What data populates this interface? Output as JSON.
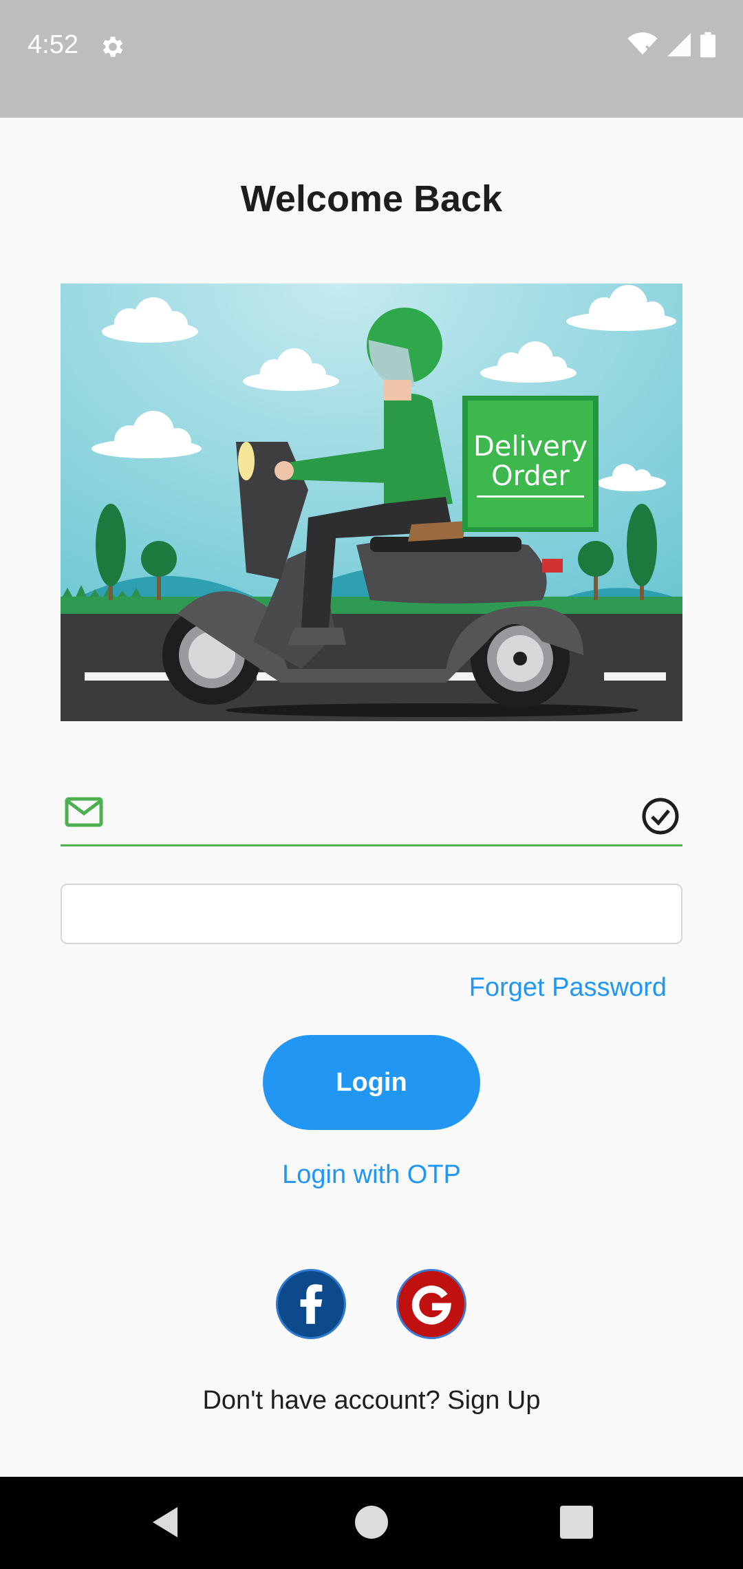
{
  "status_bar": {
    "time": "4:52",
    "icons": [
      "gear-icon",
      "wifi-icon",
      "signal-icon",
      "battery-icon"
    ]
  },
  "page": {
    "title": "Welcome Back",
    "hero_image": {
      "box_text_line1": "Delivery",
      "box_text_line2": "Order"
    }
  },
  "form": {
    "email": {
      "value": "",
      "placeholder": "",
      "icon": "mail-icon",
      "status_icon": "check-circle-icon"
    },
    "password": {
      "value": "",
      "placeholder": ""
    },
    "forget_password_label": "Forget Password",
    "login_label": "Login",
    "otp_label": "Login with OTP"
  },
  "social": {
    "facebook_icon": "facebook-icon",
    "google_icon": "google-icon"
  },
  "footer": {
    "signup_text": "Don't have account? Sign Up"
  },
  "colors": {
    "accent": "#2196f3",
    "success": "#4caf50",
    "status_bar": "#bdbdbd",
    "background": "#f9f9f9"
  },
  "nav_bar": {
    "icons": [
      "back-icon",
      "home-icon",
      "recents-icon"
    ]
  }
}
